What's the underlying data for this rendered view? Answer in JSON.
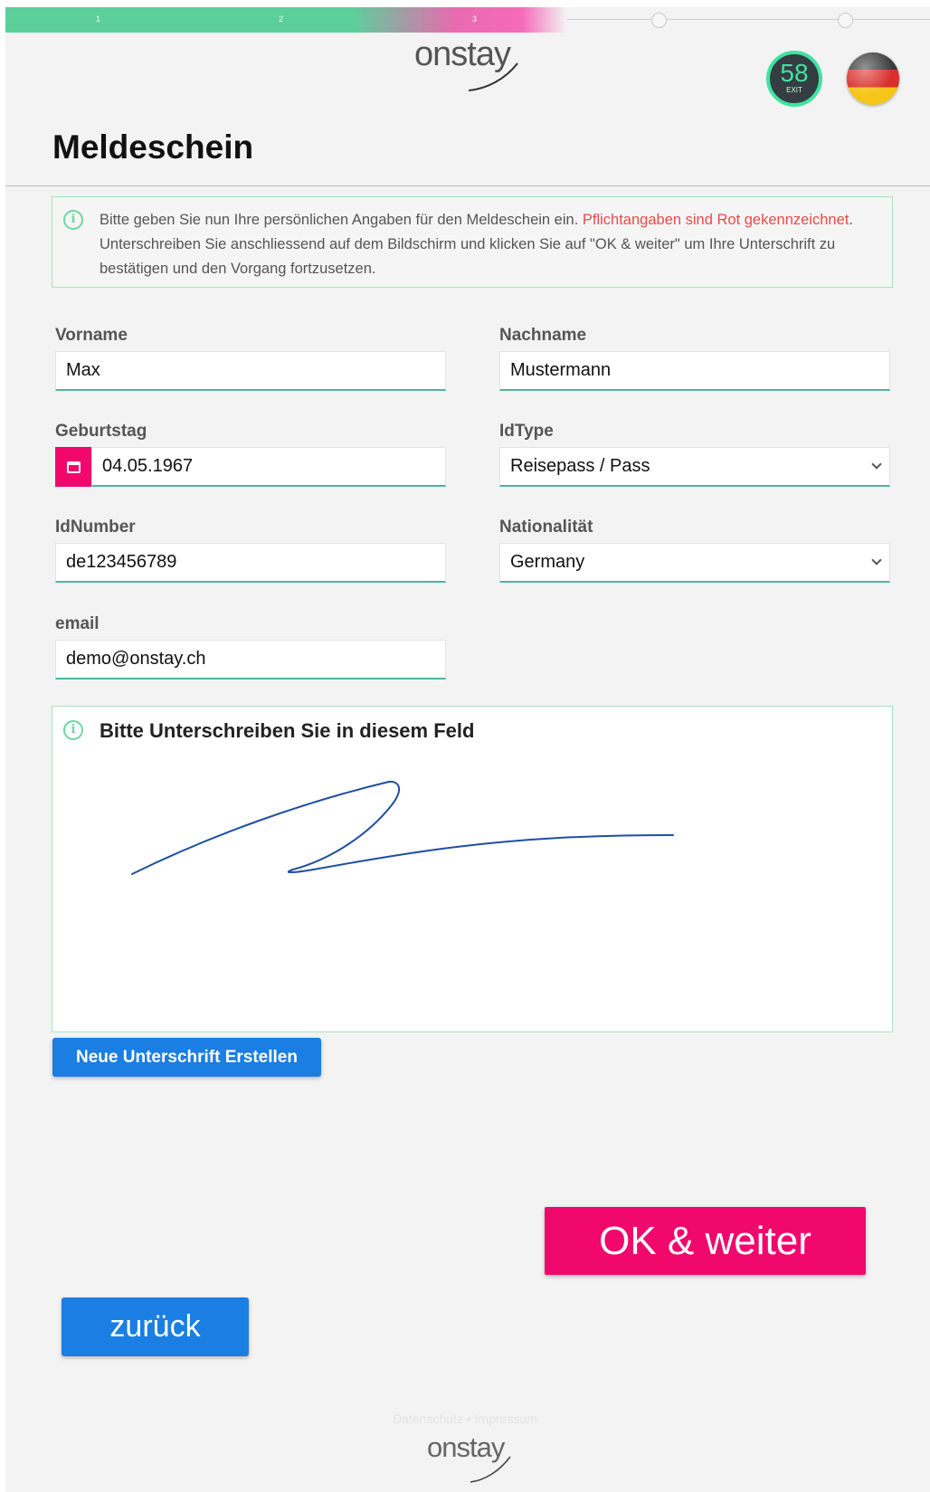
{
  "progress": {
    "steps": [
      "1",
      "2",
      "3"
    ]
  },
  "header": {
    "logo_text": "onstay",
    "timer_value": "58",
    "timer_label": "EXIT",
    "language_flag": "german-flag-icon"
  },
  "page": {
    "title": "Meldeschein"
  },
  "info": {
    "text_before": "Bitte geben Sie nun Ihre persönlichen Angaben für den Meldeschein ein. ",
    "text_required": "Pflichtangaben sind Rot gekennzeichnet",
    "text_after": ". Unterschreiben Sie anschliessend auf dem Bildschirm und klicken Sie auf \"OK & weiter\" um Ihre Unterschrift zu bestätigen und den Vorgang fortzusetzen.",
    "icon": "info-icon"
  },
  "form": {
    "firstname_label": "Vorname",
    "firstname_value": "Max",
    "lastname_label": "Nachname",
    "lastname_value": "Mustermann",
    "birthday_label": "Geburtstag",
    "birthday_value": "04.05.1967",
    "idtype_label": "IdType",
    "idtype_value": "Reisepass / Pass",
    "idnumber_label": "IdNumber",
    "idnumber_value": "de123456789",
    "nationality_label": "Nationalität",
    "nationality_value": "Germany",
    "email_label": "email",
    "email_value": "demo@onstay.ch"
  },
  "signature": {
    "title": "Bitte Unterschreiben Sie in diesem Feld",
    "new_button": "Neue Unterschrift Erstellen",
    "stroke_color": "#1f4fa0"
  },
  "actions": {
    "ok_label": "OK & weiter",
    "back_label": "zurück"
  },
  "footer": {
    "privacy": "Datenschutz",
    "separator": "•",
    "imprint": "Impressum",
    "logo_text": "onstay"
  },
  "colors": {
    "accent_pink": "#f0086d",
    "accent_blue": "#1a7ee2",
    "accent_green": "#5ccf9a"
  }
}
